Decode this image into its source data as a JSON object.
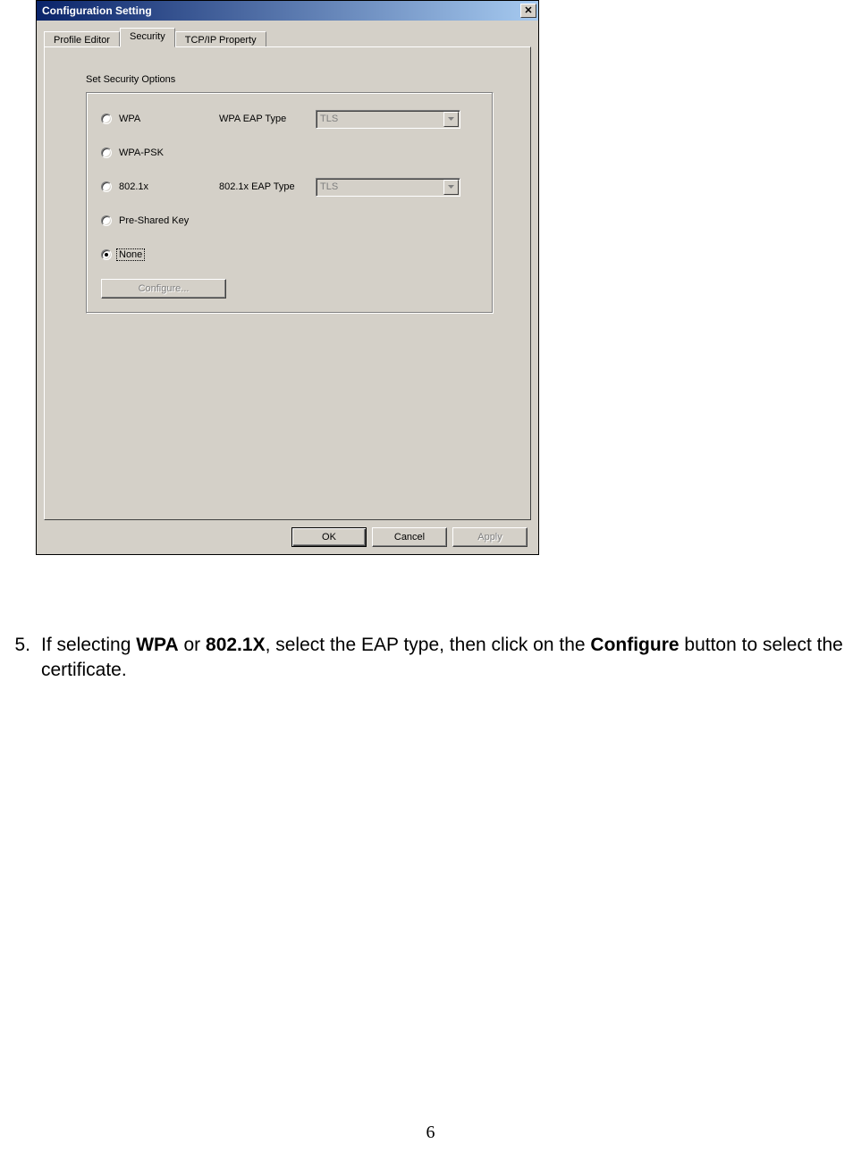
{
  "dialog": {
    "title": "Configuration Setting",
    "close": "✕",
    "tabs": {
      "profile": "Profile Editor",
      "security": "Security",
      "tcpip": "TCP/IP Property"
    },
    "section_label": "Set Security Options",
    "options": {
      "wpa": "WPA",
      "wpa_psk": "WPA-PSK",
      "x8021": "802.1x",
      "psk": "Pre-Shared Key",
      "none": "None"
    },
    "eap": {
      "wpa_label": "WPA EAP Type",
      "x8021_label": "802.1x EAP Type",
      "wpa_value": "TLS",
      "x8021_value": "TLS"
    },
    "configure_btn": "Configure...",
    "ok": "OK",
    "cancel": "Cancel",
    "apply": "Apply"
  },
  "instruction": {
    "num": "5.",
    "pre": "If selecting ",
    "bold1": "WPA",
    "mid1": " or ",
    "bold2": "802.1X",
    "mid2": ", select the EAP type, then click on the ",
    "bold3": "Configure",
    "post": " button to select the certificate."
  },
  "page_number": "6"
}
